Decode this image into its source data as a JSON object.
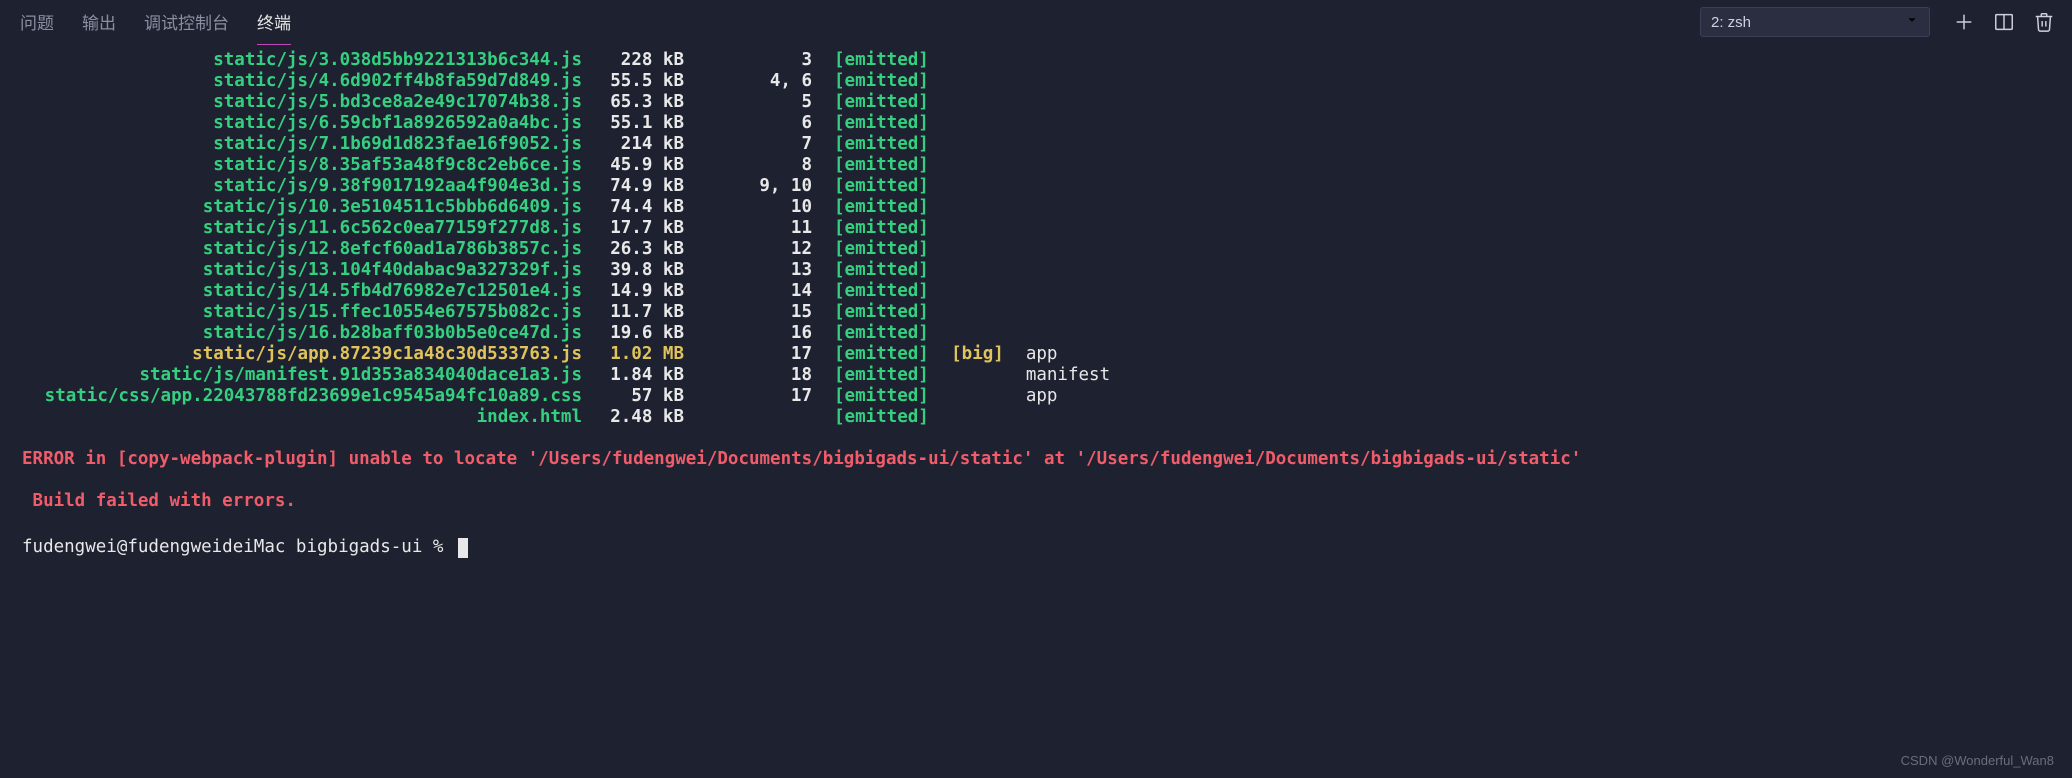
{
  "tabs": {
    "problems": "问题",
    "output": "输出",
    "debug_console": "调试控制台",
    "terminal": "终端"
  },
  "shell_selector": "2: zsh",
  "assets": [
    {
      "file": "static/js/3.038d5bb9221313b6c344.js",
      "size": "228 kB",
      "chunks": "3",
      "flags": "[emitted]",
      "big": "",
      "name": "",
      "highlight": "green"
    },
    {
      "file": "static/js/4.6d902ff4b8fa59d7d849.js",
      "size": "55.5 kB",
      "chunks": "4, 6",
      "flags": "[emitted]",
      "big": "",
      "name": "",
      "highlight": "green"
    },
    {
      "file": "static/js/5.bd3ce8a2e49c17074b38.js",
      "size": "65.3 kB",
      "chunks": "5",
      "flags": "[emitted]",
      "big": "",
      "name": "",
      "highlight": "green"
    },
    {
      "file": "static/js/6.59cbf1a8926592a0a4bc.js",
      "size": "55.1 kB",
      "chunks": "6",
      "flags": "[emitted]",
      "big": "",
      "name": "",
      "highlight": "green"
    },
    {
      "file": "static/js/7.1b69d1d823fae16f9052.js",
      "size": "214 kB",
      "chunks": "7",
      "flags": "[emitted]",
      "big": "",
      "name": "",
      "highlight": "green"
    },
    {
      "file": "static/js/8.35af53a48f9c8c2eb6ce.js",
      "size": "45.9 kB",
      "chunks": "8",
      "flags": "[emitted]",
      "big": "",
      "name": "",
      "highlight": "green"
    },
    {
      "file": "static/js/9.38f9017192aa4f904e3d.js",
      "size": "74.9 kB",
      "chunks": "9, 10",
      "flags": "[emitted]",
      "big": "",
      "name": "",
      "highlight": "green"
    },
    {
      "file": "static/js/10.3e5104511c5bbb6d6409.js",
      "size": "74.4 kB",
      "chunks": "10",
      "flags": "[emitted]",
      "big": "",
      "name": "",
      "highlight": "green"
    },
    {
      "file": "static/js/11.6c562c0ea77159f277d8.js",
      "size": "17.7 kB",
      "chunks": "11",
      "flags": "[emitted]",
      "big": "",
      "name": "",
      "highlight": "green"
    },
    {
      "file": "static/js/12.8efcf60ad1a786b3857c.js",
      "size": "26.3 kB",
      "chunks": "12",
      "flags": "[emitted]",
      "big": "",
      "name": "",
      "highlight": "green"
    },
    {
      "file": "static/js/13.104f40dabac9a327329f.js",
      "size": "39.8 kB",
      "chunks": "13",
      "flags": "[emitted]",
      "big": "",
      "name": "",
      "highlight": "green"
    },
    {
      "file": "static/js/14.5fb4d76982e7c12501e4.js",
      "size": "14.9 kB",
      "chunks": "14",
      "flags": "[emitted]",
      "big": "",
      "name": "",
      "highlight": "green"
    },
    {
      "file": "static/js/15.ffec10554e67575b082c.js",
      "size": "11.7 kB",
      "chunks": "15",
      "flags": "[emitted]",
      "big": "",
      "name": "",
      "highlight": "green"
    },
    {
      "file": "static/js/16.b28baff03b0b5e0ce47d.js",
      "size": "19.6 kB",
      "chunks": "16",
      "flags": "[emitted]",
      "big": "",
      "name": "",
      "highlight": "green"
    },
    {
      "file": "static/js/app.87239c1a48c30d533763.js",
      "size": "1.02 MB",
      "chunks": "17",
      "flags": "[emitted]",
      "big": "[big]",
      "name": "app",
      "highlight": "yellow"
    },
    {
      "file": "static/js/manifest.91d353a834040dace1a3.js",
      "size": "1.84 kB",
      "chunks": "18",
      "flags": "[emitted]",
      "big": "",
      "name": "manifest",
      "highlight": "green"
    },
    {
      "file": "static/css/app.22043788fd23699e1c9545a94fc10a89.css",
      "size": "57 kB",
      "chunks": "17",
      "flags": "[emitted]",
      "big": "",
      "name": "app",
      "highlight": "green"
    },
    {
      "file": "index.html",
      "size": "2.48 kB",
      "chunks": "",
      "flags": "[emitted]",
      "big": "",
      "name": "",
      "highlight": "green"
    }
  ],
  "error_line": "ERROR in [copy-webpack-plugin] unable to locate '/Users/fudengwei/Documents/bigbigads-ui/static' at '/Users/fudengwei/Documents/bigbigads-ui/static'",
  "fail_line": " Build failed with errors.",
  "prompt": "fudengwei@fudengweideiMac bigbigads-ui % ",
  "watermark": "CSDN @Wonderful_Wan8"
}
